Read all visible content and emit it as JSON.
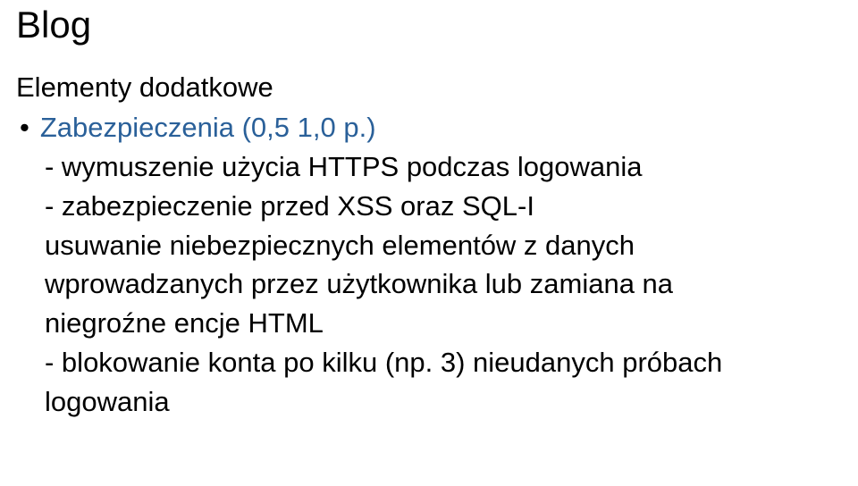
{
  "title": "Blog",
  "subtitle": "Elementy dodatkowe",
  "bullet": {
    "dot": "•",
    "text": "Zabezpieczenia (0,5 1,0 p.)"
  },
  "nested_lines": [
    "- wymuszenie użycia HTTPS podczas logowania",
    "- zabezpieczenie przed XSS oraz SQL-I",
    "usuwanie niebezpiecznych elementów z danych",
    "wprowadzanych przez użytkownika lub zamiana na",
    "niegroźne encje HTML",
    "- blokowanie konta po kilku (np. 3) nieudanych próbach",
    "logowania"
  ]
}
